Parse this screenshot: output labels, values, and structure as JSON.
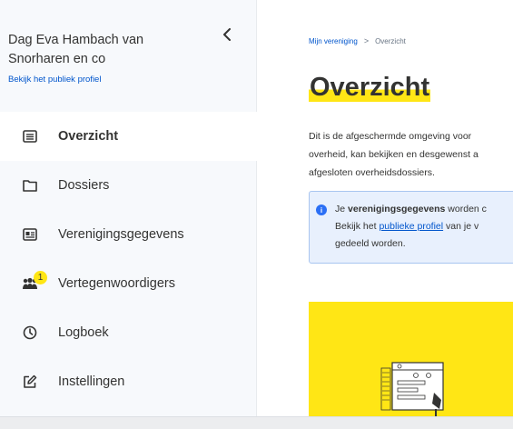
{
  "sidebar": {
    "org_name": "Dag Eva Hambach van Snorharen en co",
    "public_profile_link": "Bekijk het publiek profiel",
    "items": [
      {
        "label": "Overzicht",
        "icon": "list-icon",
        "active": true
      },
      {
        "label": "Dossiers",
        "icon": "folder-icon",
        "active": false
      },
      {
        "label": "Verenigingsgegevens",
        "icon": "id-card-icon",
        "active": false
      },
      {
        "label": "Vertegenwoordigers",
        "icon": "users-icon",
        "active": false,
        "badge": "1"
      },
      {
        "label": "Logboek",
        "icon": "clock-icon",
        "active": false
      },
      {
        "label": "Instellingen",
        "icon": "edit-icon",
        "active": false
      }
    ]
  },
  "breadcrumb": {
    "root": "Mijn vereniging",
    "separator": ">",
    "current": "Overzicht"
  },
  "main": {
    "title": "Overzicht",
    "intro_lines": [
      "Dit is de afgeschermde omgeving voor",
      "overheid, kan bekijken en desgewenst a",
      "afgesloten overheidsdossiers."
    ],
    "info": {
      "prefix": "Je ",
      "bold": "verenigingsgegevens",
      "suffix": " worden c",
      "line2_prefix": "Bekijk het ",
      "line2_link": "publieke profiel",
      "line2_suffix": " van je v",
      "line3": "gedeeld worden."
    }
  },
  "colors": {
    "accent_yellow": "#ffe615",
    "link_blue": "#0055cc",
    "info_bg": "#e8f0fd",
    "info_icon": "#2b6ff5"
  }
}
